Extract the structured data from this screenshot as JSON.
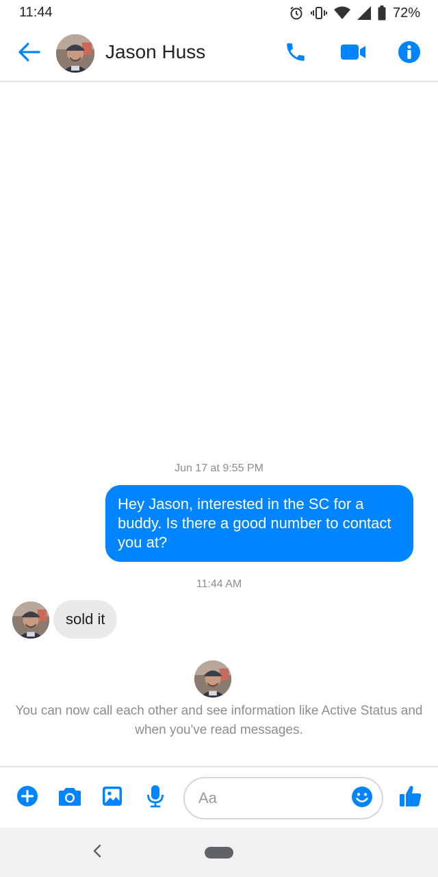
{
  "status_bar": {
    "time": "11:44",
    "battery_percent": "72%",
    "icons": [
      "alarm-icon",
      "vibrate-icon",
      "wifi-icon",
      "cell-signal-icon",
      "battery-icon"
    ]
  },
  "header": {
    "contact_name": "Jason Huss",
    "icons": [
      "back-arrow-icon",
      "phone-icon",
      "video-camera-icon",
      "info-icon"
    ]
  },
  "conversation": {
    "messages": [
      {
        "timestamp": "Jun 17 at 9:55 PM",
        "direction": "outgoing",
        "text": "Hey Jason, interested in the SC for a buddy. Is there a good number to contact you at?"
      },
      {
        "timestamp": "11:44 AM",
        "direction": "incoming",
        "text": "sold it"
      }
    ],
    "notice": "You can now call each other and see information like Active Status and when you've read messages."
  },
  "composer": {
    "placeholder": "Aa",
    "icons": [
      "plus-icon",
      "camera-icon",
      "gallery-icon",
      "microphone-icon",
      "emoji-icon",
      "thumbs-up-icon"
    ]
  },
  "colors": {
    "accent": "#0084ff",
    "outgoing_bubble": "#0084ff",
    "incoming_bubble": "#e9e9eb",
    "meta_text": "#8a8d91"
  }
}
